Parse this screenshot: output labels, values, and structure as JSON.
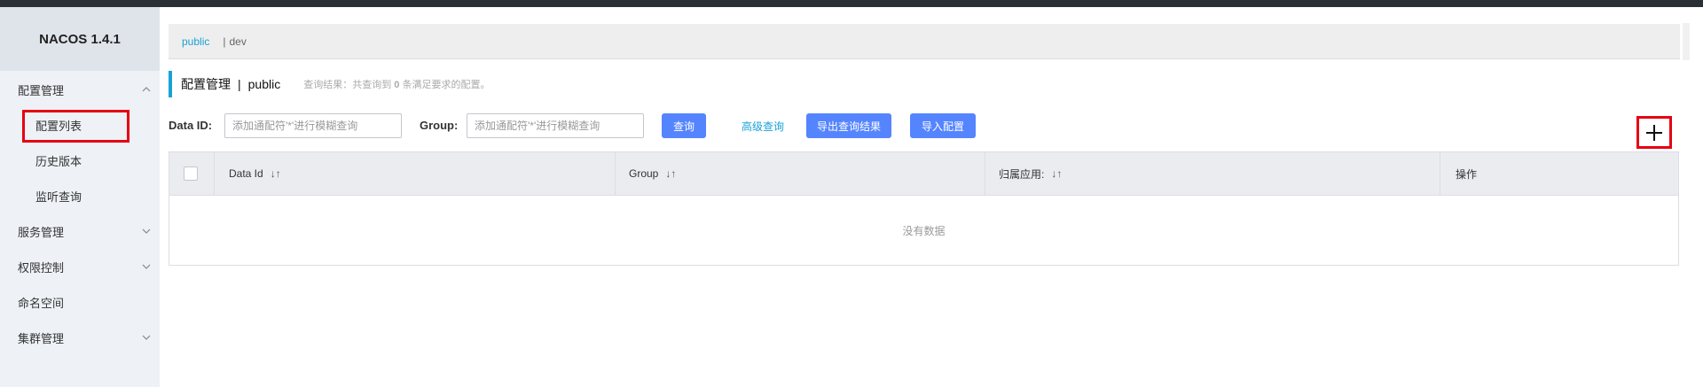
{
  "app": {
    "brand": "NACOS 1.4.1"
  },
  "sidebar": {
    "items": [
      {
        "label": "配置管理",
        "expandable": true,
        "expanded": true
      },
      {
        "label": "配置列表",
        "sub": true,
        "selected": true
      },
      {
        "label": "历史版本",
        "sub": true
      },
      {
        "label": "监听查询",
        "sub": true
      },
      {
        "label": "服务管理",
        "expandable": true
      },
      {
        "label": "权限控制",
        "expandable": true
      },
      {
        "label": "命名空间"
      },
      {
        "label": "集群管理",
        "expandable": true
      }
    ]
  },
  "namespace_bar": {
    "active": "public",
    "separator": "|",
    "other": "dev"
  },
  "title": {
    "main": "配置管理",
    "separator": "|",
    "namespace": "public",
    "hint_prefix": "查询结果：共查询到",
    "hint_count": "0",
    "hint_suffix": "条满足要求的配置。"
  },
  "search": {
    "data_id_label": "Data ID:",
    "data_id_placeholder": "添加通配符'*'进行模糊查询",
    "group_label": "Group:",
    "group_placeholder": "添加通配符'*'进行模糊查询",
    "query_button": "查询",
    "advanced_link": "高级查询",
    "export_button": "导出查询结果",
    "import_button": "导入配置"
  },
  "add_button": {
    "icon": "plus-icon"
  },
  "table": {
    "columns": [
      {
        "label": "Data Id",
        "sortable": true
      },
      {
        "label": "Group",
        "sortable": true
      },
      {
        "label": "归属应用:",
        "sortable": true
      },
      {
        "label": "操作",
        "sortable": false
      }
    ],
    "sort_glyph": "↓↑",
    "rows": [],
    "empty_text": "没有数据"
  },
  "colors": {
    "accent": "#1aa1d6",
    "primary_button": "#5584ff",
    "highlight_box": "#e60012"
  }
}
